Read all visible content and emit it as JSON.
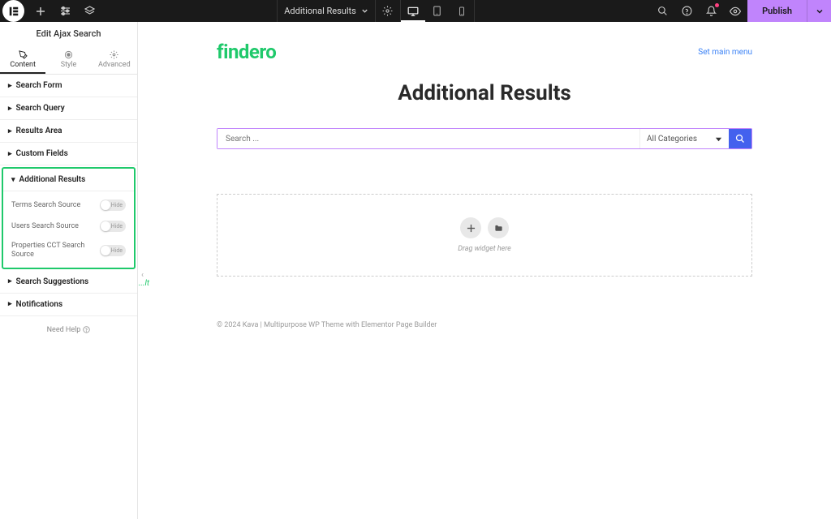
{
  "topbar": {
    "doc_title": "Additional Results",
    "publish": "Publish"
  },
  "sidebar": {
    "panel_title": "Edit Ajax Search",
    "tabs": {
      "content": "Content",
      "style": "Style",
      "advanced": "Advanced"
    },
    "sections": {
      "search_form": "Search Form",
      "search_query": "Search Query",
      "results_area": "Results Area",
      "custom_fields": "Custom Fields",
      "additional_results": "Additional Results",
      "search_suggestions": "Search Suggestions",
      "notifications": "Notifications"
    },
    "controls": {
      "terms_search": "Terms Search Source",
      "users_search": "Users Search Source",
      "props_cct_search": "Properties CCT Search Source",
      "toggle_hide": "Hide"
    },
    "help": "Need Help",
    "stray": "...lt"
  },
  "canvas": {
    "logo": "findero",
    "menu_link": "Set main menu",
    "heading": "Additional Results",
    "search_placeholder": "Search ...",
    "category_label": "All Categories",
    "drag_text": "Drag widget here",
    "footer": "© 2024 Kava | Multipurpose WP Theme with Elementor Page Builder"
  }
}
